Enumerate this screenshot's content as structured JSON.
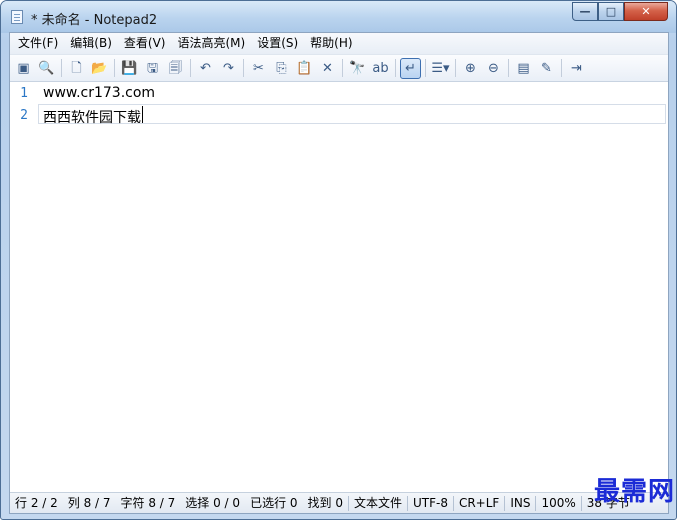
{
  "window": {
    "title": "* 未命名 - Notepad2",
    "minimize_glyph": "—",
    "maximize_glyph": "□",
    "close_glyph": "✕"
  },
  "menu": [
    "文件(F)",
    "编辑(B)",
    "查看(V)",
    "语法高亮(M)",
    "设置(S)",
    "帮助(H)"
  ],
  "toolbar": {
    "groups": [
      [
        {
          "icon": "new-window-icon",
          "glyph": "▣"
        },
        {
          "icon": "browse-icon",
          "glyph": "🔍"
        }
      ],
      [
        {
          "icon": "new-file-icon",
          "glyph": "🗋"
        },
        {
          "icon": "open-folder-icon",
          "glyph": "📂"
        }
      ],
      [
        {
          "icon": "save-icon",
          "glyph": "💾"
        },
        {
          "icon": "save-as-icon",
          "glyph": "🖫"
        },
        {
          "icon": "save-copy-icon",
          "glyph": "🗐"
        }
      ],
      [
        {
          "icon": "undo-icon",
          "glyph": "↶"
        },
        {
          "icon": "redo-icon",
          "glyph": "↷"
        }
      ],
      [
        {
          "icon": "cut-icon",
          "glyph": "✂"
        },
        {
          "icon": "copy-icon",
          "glyph": "⎘"
        },
        {
          "icon": "paste-icon",
          "glyph": "📋"
        },
        {
          "icon": "delete-icon",
          "glyph": "✕"
        }
      ],
      [
        {
          "icon": "find-icon",
          "glyph": "🔭"
        },
        {
          "icon": "replace-icon",
          "glyph": "ab"
        }
      ],
      [
        {
          "icon": "word-wrap-icon",
          "glyph": "↵",
          "active": true
        }
      ],
      [
        {
          "icon": "list-options-icon",
          "glyph": "☰▾"
        }
      ],
      [
        {
          "icon": "zoom-in-icon",
          "glyph": "⊕"
        },
        {
          "icon": "zoom-out-icon",
          "glyph": "⊖"
        }
      ],
      [
        {
          "icon": "scheme-icon",
          "glyph": "▤"
        },
        {
          "icon": "customize-icon",
          "glyph": "✎"
        }
      ],
      [
        {
          "icon": "exit-icon",
          "glyph": "⇥"
        }
      ]
    ]
  },
  "editor": {
    "lines": [
      {
        "num": "1",
        "text": "www.cr173.com"
      },
      {
        "num": "2",
        "text": "西西软件园下载"
      }
    ]
  },
  "status": [
    "行 2 / 2",
    "列 8 / 7",
    "字符 8 / 7",
    "选择 0 / 0",
    "已选行 0",
    "找到 0",
    "文本文件",
    "UTF-8",
    "CR+LF",
    "INS",
    "100%",
    "38 字节"
  ],
  "watermark": "最需网"
}
